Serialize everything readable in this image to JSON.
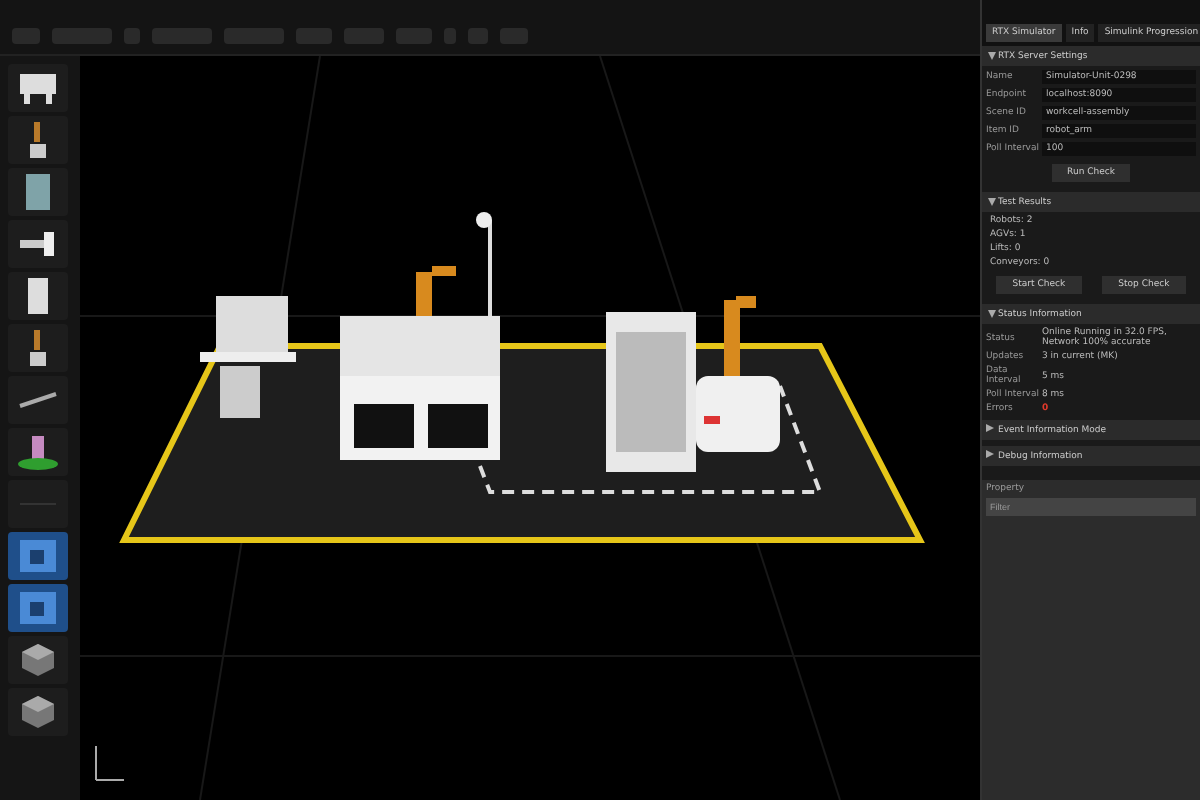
{
  "panel": {
    "tabs": [
      {
        "label": "RTX Simulator",
        "selected": true
      },
      {
        "label": "Info",
        "selected": false
      },
      {
        "label": "Simulink Progression",
        "selected": false
      }
    ],
    "sections": [
      {
        "title": "RTX Server Settings",
        "expanded": true,
        "fields": [
          {
            "label": "Name",
            "value": "Simulator-Unit-0298",
            "kind": "input"
          },
          {
            "label": "Endpoint",
            "value": "localhost:8090",
            "kind": "input"
          },
          {
            "label": "Scene ID",
            "value": "workcell-assembly",
            "kind": "input"
          },
          {
            "label": "Item ID",
            "value": "robot_arm",
            "kind": "input"
          },
          {
            "label": "Poll Interval",
            "value": "100",
            "kind": "input"
          }
        ],
        "buttons": [
          "Run Check"
        ]
      },
      {
        "title": "Test Results",
        "expanded": true,
        "lines": [
          "Robots: 2",
          "AGVs: 1",
          "Lifts: 0",
          "Conveyors: 0"
        ],
        "buttons": [
          "Start Check",
          "Stop Check"
        ]
      },
      {
        "title": "Status Information",
        "expanded": true,
        "fields": [
          {
            "label": "Status",
            "value": "Online Running in 32.0 FPS, Network 100% accurate",
            "kind": "status"
          },
          {
            "label": "Updates",
            "value": "3 in current (MK)",
            "kind": "status"
          },
          {
            "label": "Data Interval",
            "value": "5 ms",
            "kind": "status"
          },
          {
            "label": "Poll Interval",
            "value": "8 ms",
            "kind": "status"
          },
          {
            "label": "Errors",
            "value": "0",
            "kind": "error"
          }
        ]
      },
      {
        "title": "Event Information Mode",
        "expanded": false
      },
      {
        "title": "Debug Information",
        "expanded": false
      }
    ],
    "property": {
      "title": "Property",
      "search": {
        "placeholder": "Filter"
      }
    }
  }
}
